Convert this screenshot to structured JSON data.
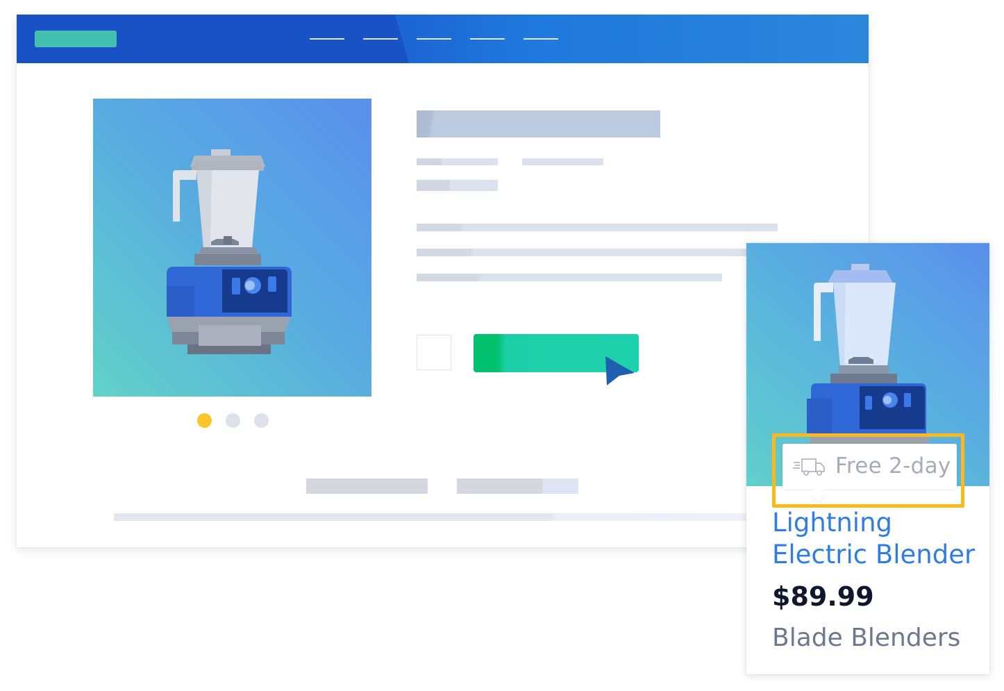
{
  "colors": {
    "header": "#1b5fd2",
    "logo": "#43c0b0",
    "cta": "#1dcfa7",
    "highlight": "#fbb920",
    "link": "#2f7de2",
    "carousel_active": "#fac529"
  },
  "icons": {
    "cursor": "cursor-arrow-icon",
    "shipping": "delivery-truck-icon",
    "product": "blender-illustration"
  },
  "carousel": {
    "count": 3,
    "active_index": 0
  },
  "card": {
    "badge_text": "Free 2-day",
    "product_name_line1": "Lightning",
    "product_name_line2": "Electric Blender",
    "price": "$89.99",
    "category": "Blade Blenders"
  }
}
